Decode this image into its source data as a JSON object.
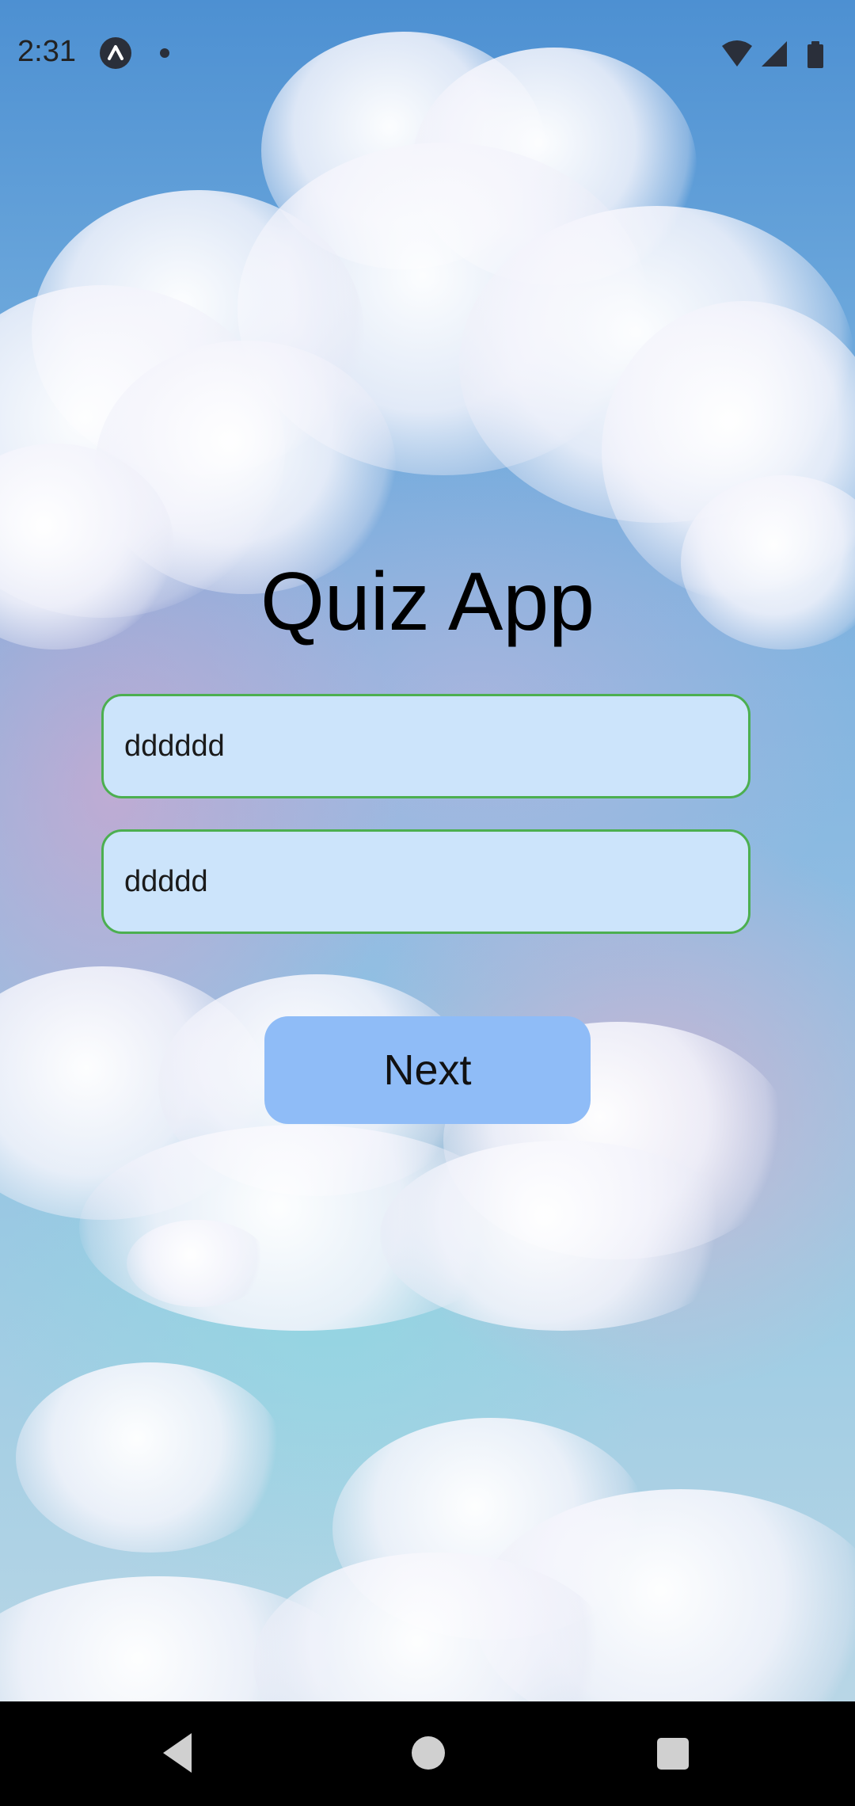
{
  "status_bar": {
    "time": "2:31",
    "icons": [
      "app-notification-icon",
      "notification-dot-icon",
      "wifi-icon",
      "signal-icon",
      "battery-icon"
    ]
  },
  "app": {
    "title": "Quiz App"
  },
  "form": {
    "field_1_value": "dddddd",
    "field_2_value": "ddddd",
    "next_label": "Next"
  },
  "nav_bar": {
    "icons": [
      "back-icon",
      "home-icon",
      "recents-icon"
    ]
  },
  "colors": {
    "field_background": "#cce4fb",
    "field_border": "#4caf50",
    "button_background": "#8fbcf7",
    "nav_background": "#000000"
  }
}
